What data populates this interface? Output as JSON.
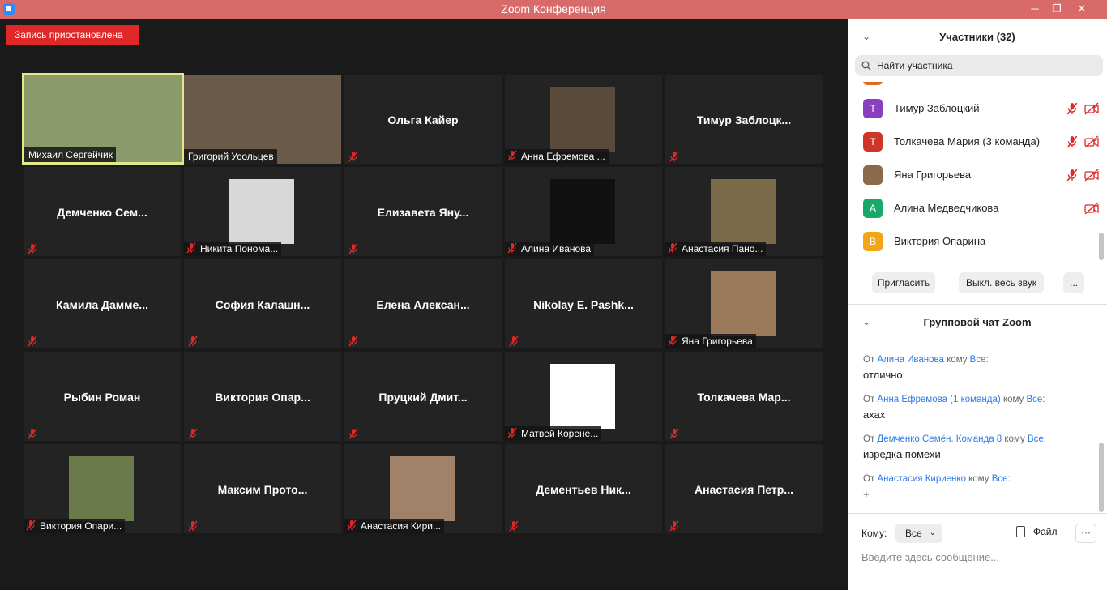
{
  "window": {
    "title": "Zoom Конференция",
    "minimize": "─",
    "restore": "❐",
    "close": "✕"
  },
  "recording": {
    "label": "Запись приостановлена"
  },
  "tiles": [
    {
      "name": "Михаил Сергейчик",
      "kind": "video",
      "color": "#8a9a6a",
      "active": true
    },
    {
      "name": "Григорий Усольцев",
      "kind": "video",
      "color": "#6a5a4a"
    },
    {
      "name": "Ольга Кайер",
      "kind": "name"
    },
    {
      "name": "Анна Ефремова ...",
      "kind": "photo",
      "color": "#5a4a3a"
    },
    {
      "name": "Тимур Заблоцк...",
      "kind": "name"
    },
    {
      "name": "Демченко Сем...",
      "kind": "name"
    },
    {
      "name": "Никита Понома...",
      "kind": "photo",
      "color": "#d8d8d8"
    },
    {
      "name": "Елизавета Яну...",
      "kind": "name"
    },
    {
      "name": "Алина Иванова",
      "kind": "photo",
      "color": "#111111"
    },
    {
      "name": "Анастасия Пано...",
      "kind": "photo",
      "color": "#7a6a4a"
    },
    {
      "name": "Камила Дамме...",
      "kind": "name"
    },
    {
      "name": "София Калашн...",
      "kind": "name"
    },
    {
      "name": "Елена Алексан...",
      "kind": "name"
    },
    {
      "name": "Nikolay E. Pashk...",
      "kind": "name"
    },
    {
      "name": "Яна Григорьева",
      "kind": "photo",
      "color": "#9a7a5a"
    },
    {
      "name": "Рыбин Роман",
      "kind": "name"
    },
    {
      "name": "Виктория Опар...",
      "kind": "name"
    },
    {
      "name": "Пруцкий Дмит...",
      "kind": "name"
    },
    {
      "name": "Матвей Корене...",
      "kind": "photo",
      "color": "#ffffff"
    },
    {
      "name": "Толкачева Мар...",
      "kind": "name"
    },
    {
      "name": "Виктория Опари...",
      "kind": "photo",
      "color": "#6a7a4a"
    },
    {
      "name": "Максим Прото...",
      "kind": "name"
    },
    {
      "name": "Анастасия Кири...",
      "kind": "photo",
      "color": "#a0826a"
    },
    {
      "name": "Дементьев Ник...",
      "kind": "name"
    },
    {
      "name": "Анастасия Петр...",
      "kind": "name"
    }
  ],
  "participants": {
    "header": "Участники (32)",
    "search_placeholder": "Найти участника",
    "list": [
      {
        "initial": "T",
        "name": "Тимур Заблоцкий",
        "color": "#8a3fbf",
        "muted": true,
        "video_off": true
      },
      {
        "initial": "T",
        "name": "Толкачева Мария (3 команда)",
        "color": "#d0352a",
        "muted": true,
        "video_off": true
      },
      {
        "initial": "",
        "name": "Яна Григорьева",
        "color": "#8a6a4a",
        "muted": true,
        "video_off": true
      },
      {
        "initial": "A",
        "name": "Алина Медведчикова",
        "color": "#1aa86a",
        "muted": false,
        "video_off": true
      },
      {
        "initial": "B",
        "name": "Виктория Опарина",
        "color": "#f2a516",
        "muted": false,
        "video_off": false
      }
    ],
    "invite": "Пригласить",
    "mute_all": "Выкл. весь звук",
    "more": "..."
  },
  "chat": {
    "header": "Групповой чат Zoom",
    "from_word": "От",
    "to_word": "кому",
    "messages": [
      {
        "from": "Алина Иванова",
        "to": "Все:",
        "text": "отлично"
      },
      {
        "from": "Анна Ефремова (1 команда)",
        "to": "Все:",
        "text": "ахах"
      },
      {
        "from": "Демченко Семён. Команда 8",
        "to": "Все:",
        "text": "изредка помехи"
      },
      {
        "from": "Анастасия Кириенко",
        "to": "Все:",
        "text": "+"
      }
    ],
    "to_label": "Кому:",
    "to_value": "Все",
    "file": "Файл",
    "more": "···",
    "input_placeholder": "Введите здесь сообщение..."
  }
}
